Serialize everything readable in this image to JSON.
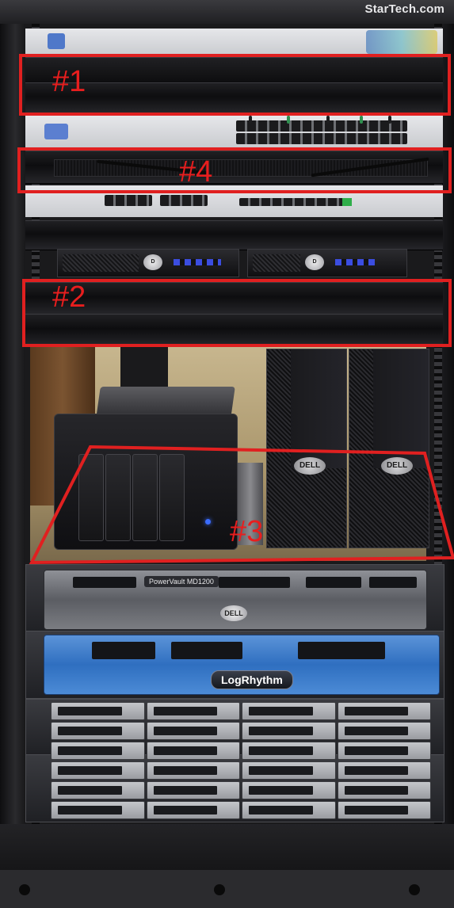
{
  "brand_text": "StarTech.com",
  "equipment_labels": {
    "storage_model": "PowerVault MD1200",
    "dell_logo": "DELL",
    "bezel_badge": "LogRhythm"
  },
  "annotations": [
    {
      "id": "annotation-1",
      "label": "#1"
    },
    {
      "id": "annotation-4",
      "label": "#4"
    },
    {
      "id": "annotation-2",
      "label": "#2"
    },
    {
      "id": "annotation-3",
      "label": "#3"
    }
  ],
  "colors": {
    "annotation_red": "#e02020",
    "logrhythm_blue": "#2f6fc0",
    "rack_black": "#141416"
  }
}
